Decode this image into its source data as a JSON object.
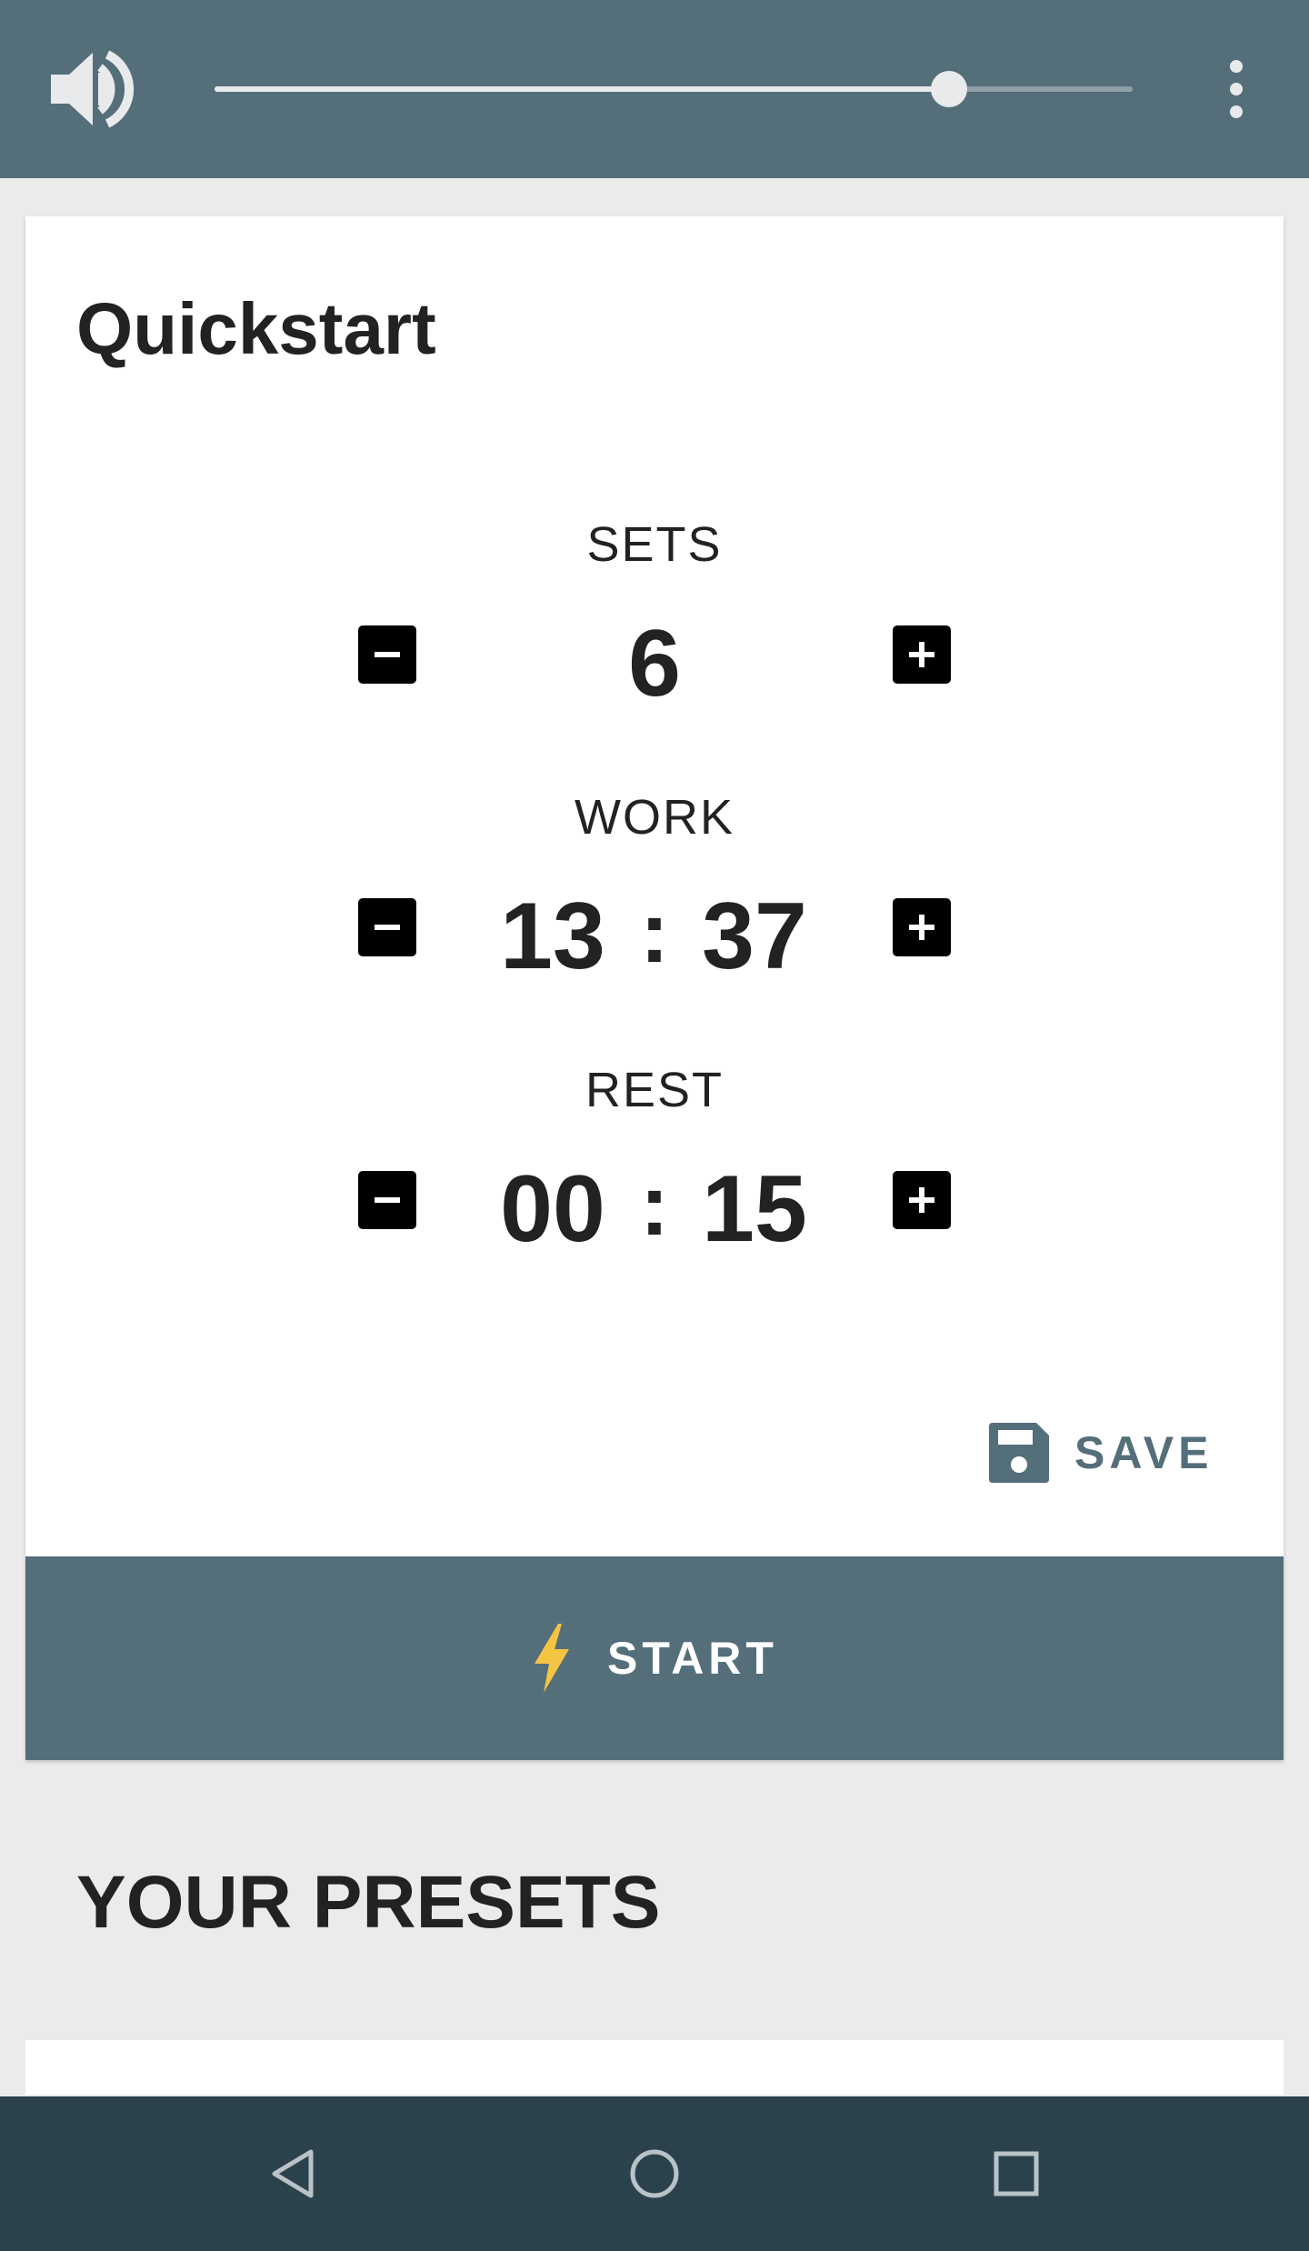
{
  "colors": {
    "primary": "#546e7a",
    "nav_bar": "#2b424d",
    "accent": "#f5c542",
    "background": "#ebebeb",
    "card": "#ffffff",
    "text": "#222222"
  },
  "top_bar": {
    "volume_icon": "volume-up-icon",
    "volume_level": 0.8,
    "menu_icon": "more-vert-icon"
  },
  "quickstart": {
    "title": "Quickstart",
    "sets": {
      "label": "SETS",
      "value": "6",
      "decrement_icon": "minus-box-icon",
      "increment_icon": "plus-box-icon"
    },
    "work": {
      "label": "WORK",
      "minutes": "13",
      "separator": ":",
      "seconds": "37"
    },
    "rest": {
      "label": "REST",
      "minutes": "00",
      "separator": ":",
      "seconds": "15"
    },
    "save": {
      "icon": "floppy-disk-icon",
      "label": "SAVE"
    },
    "start": {
      "icon": "lightning-bolt-icon",
      "label": "START"
    }
  },
  "presets": {
    "heading": "YOUR PRESETS"
  },
  "nav_bar": {
    "back_icon": "back-triangle-icon",
    "home_icon": "home-circle-icon",
    "recents_icon": "recents-square-icon"
  }
}
